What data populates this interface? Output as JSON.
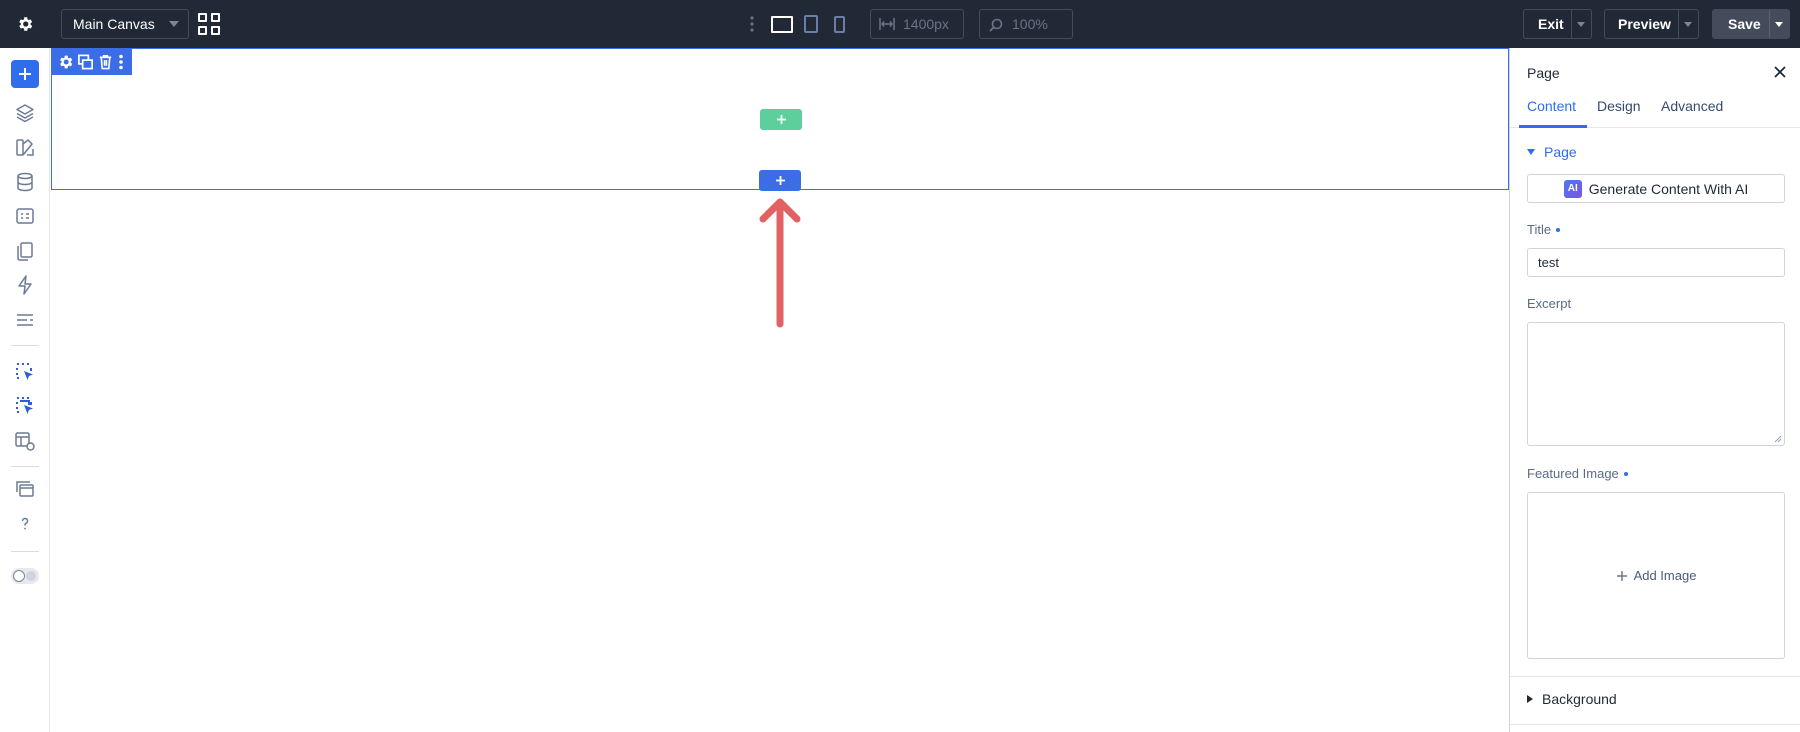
{
  "topbar": {
    "canvas_select": "Main Canvas",
    "width_value": "1400px",
    "zoom_value": "100%",
    "exit_label": "Exit",
    "preview_label": "Preview",
    "save_label": "Save",
    "active_device": "desktop"
  },
  "sidebar": {
    "icons": [
      "add-icon",
      "layers-icon",
      "brush-icon",
      "database-icon",
      "form-icon",
      "pages-icon",
      "lightning-icon",
      "list-icon",
      "select-element-icon",
      "multi-select-icon",
      "layout-settings-icon",
      "window-stack-icon",
      "help-icon",
      "theme-toggle-icon"
    ]
  },
  "canvas": {
    "section_toolbar_icons": [
      "gear-icon",
      "duplicate-icon",
      "trash-icon",
      "more-vertical-icon"
    ],
    "accent_color": "#3b6ee6",
    "add_row_color": "#5ccf9d",
    "arrow_color": "#e06262"
  },
  "panel": {
    "title": "Page",
    "tabs": [
      {
        "label": "Content",
        "active": true
      },
      {
        "label": "Design",
        "active": false
      },
      {
        "label": "Advanced",
        "active": false
      }
    ],
    "group_label": "Page",
    "ai_badge": "AI",
    "ai_button": "Generate Content With AI",
    "title_label": "Title",
    "title_value": "test",
    "excerpt_label": "Excerpt",
    "excerpt_value": "",
    "featured_image_label": "Featured Image",
    "add_image_label": "Add Image",
    "background_label": "Background"
  }
}
